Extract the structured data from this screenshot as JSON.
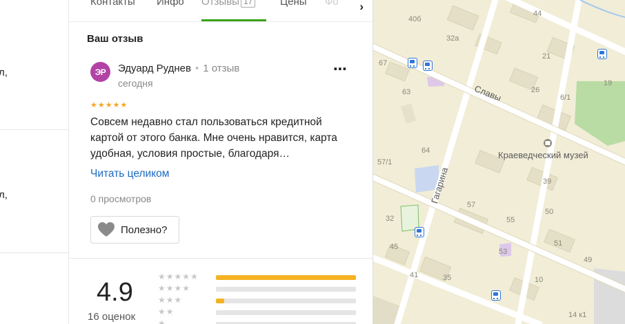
{
  "left_list": {
    "snippets": [
      "л,",
      "л,"
    ]
  },
  "tabs": {
    "items": [
      {
        "label": "Контакты"
      },
      {
        "label": "Инфо"
      },
      {
        "label": "Отзывы",
        "count": "17"
      },
      {
        "label": "Цены"
      },
      {
        "label": "Фо"
      }
    ]
  },
  "review": {
    "section_title": "Ваш отзыв",
    "avatar_initials": "ЭР",
    "author": "Эдуард Руднев",
    "author_reviews": "1 отзыв",
    "date": "сегодня",
    "stars": 5,
    "text": "Совсем недавно стал пользоваться кредитной картой от этого банка. Мне очень нравится, карта удобная, условия простые, благодаря…",
    "read_more": "Читать целиком",
    "views": "0 просмотров",
    "useful_label": "Полезно?"
  },
  "summary": {
    "score": "4.9",
    "count": "16 оценок",
    "distribution": [
      {
        "stars": 5,
        "fraction": 1.0
      },
      {
        "stars": 4,
        "fraction": 0.0
      },
      {
        "stars": 3,
        "fraction": 0.06
      },
      {
        "stars": 2,
        "fraction": 0.0
      },
      {
        "stars": 1,
        "fraction": 0.0
      }
    ]
  },
  "map": {
    "streets": [
      "Славы",
      "Гагарина"
    ],
    "poi": "Краеведческий музей",
    "house_numbers": [
      "40б",
      "32а",
      "44",
      "67",
      "21",
      "19",
      "63",
      "26",
      "6/1",
      "64",
      "57/1",
      "39",
      "57",
      "50",
      "32",
      "55",
      "51",
      "45",
      "53",
      "49",
      "41",
      "35",
      "10",
      "14 к1"
    ]
  },
  "colors": {
    "accent": "#39a21b",
    "star": "#f5a623",
    "bar": "#f5b324",
    "link": "#1a6ac2",
    "avatar": "#b242a6"
  }
}
